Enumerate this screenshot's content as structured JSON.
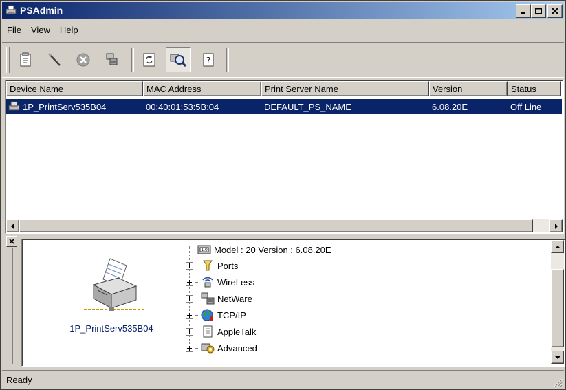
{
  "window": {
    "title": "PSAdmin",
    "title_icon": "printer-app-icon"
  },
  "controls": {
    "minimize": "_",
    "maximize": "□",
    "close": "×"
  },
  "menu": [
    {
      "label": "File",
      "accel": "F",
      "rest": "ile"
    },
    {
      "label": "View",
      "accel": "V",
      "rest": "iew"
    },
    {
      "label": "Help",
      "accel": "H",
      "rest": "elp"
    }
  ],
  "toolbar": [
    {
      "name": "properties",
      "icon": "properties-icon"
    },
    {
      "name": "upgrade",
      "icon": "wand-icon"
    },
    {
      "name": "delete",
      "icon": "stop-icon"
    },
    {
      "name": "connect",
      "icon": "network-server-icon"
    },
    {
      "name": "refresh",
      "icon": "refresh-icon"
    },
    {
      "name": "search",
      "icon": "search-icon",
      "pressed": true
    },
    {
      "name": "help",
      "icon": "help-icon"
    }
  ],
  "list": {
    "columns": [
      "Device Name",
      "MAC Address",
      "Print Server Name",
      "Version",
      "Status"
    ],
    "rows": [
      {
        "device": "1P_PrintServ535B04",
        "mac": "00:40:01:53:5B:04",
        "server": "DEFAULT_PS_NAME",
        "version": "6.08.20E",
        "status": "Off Line",
        "selected": true
      }
    ]
  },
  "detail": {
    "device_label": "1P_PrintServ535B04",
    "model_line": "Model : 20   Version : 6.08.20E",
    "tree": [
      "Ports",
      "WireLess",
      "NetWare",
      "TCP/IP",
      "AppleTalk",
      "Advanced"
    ]
  },
  "status": {
    "text": "Ready"
  },
  "colors": {
    "selection": "#0a246a",
    "titlebar_start": "#0a246a",
    "titlebar_end": "#a6caf0",
    "face": "#d4d0c8"
  }
}
